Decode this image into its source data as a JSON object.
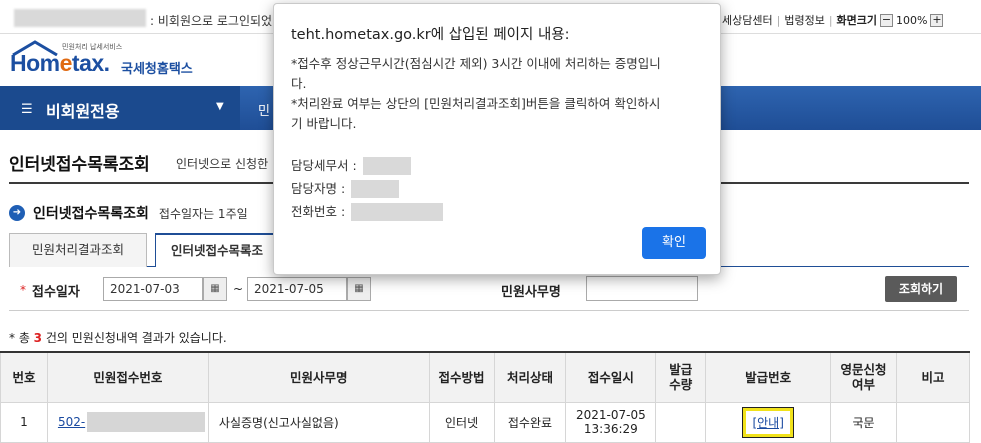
{
  "topbar": {
    "notice": ": 비회원으로 로그인되었",
    "links": [
      "세상담센터",
      "법령정보",
      "화면크기"
    ],
    "zoom_minus": "−",
    "zoom_value": "100%",
    "zoom_plus": "+"
  },
  "logo": {
    "small": "민원처리 납세서비스",
    "main_a": "Hom",
    "main_b": "e",
    "main_c": "tax.",
    "sub": "국세청홈택스"
  },
  "nav": {
    "title": "비회원전용",
    "second": "민"
  },
  "page": {
    "title": "인터넷접수목록조회",
    "desc": "인터넷으로 신청한"
  },
  "section": {
    "title": "인터넷접수목록조회",
    "desc": "접수일자는 1주일"
  },
  "tabs": [
    "민원처리결과조회",
    "인터넷접수목록조"
  ],
  "search": {
    "star": "*",
    "date_label": "접수일자",
    "date_from": "2021-07-03",
    "date_to": "2021-07-05",
    "tilde": "~",
    "civil_label": "민원사무명",
    "civil_value": "",
    "button": "조회하기"
  },
  "result": {
    "prefix": "* 총 ",
    "count": "3",
    "suffix": " 건의 민원신청내역 결과가 있습니다."
  },
  "table": {
    "headers": [
      "번호",
      "민원접수번호",
      "민원사무명",
      "접수방법",
      "처리상태",
      "접수일시",
      "발급\n수량",
      "발급번호",
      "영문신청\n여부",
      "비고"
    ],
    "rows": [
      {
        "no": "1",
        "receipt_no": "502-",
        "name": "사실증명(신고사실없음)",
        "method": "인터넷",
        "status": "접수완료",
        "date": "2021-07-05",
        "time": "13:36:29",
        "qty": "",
        "issue_no": "[안내]",
        "english": "국문",
        "note": ""
      }
    ]
  },
  "modal": {
    "title": "teht.hometax.go.kr에 삽입된 페이지 내용:",
    "line1": "*접수후 정상근무시간(점심시간 제외) 3시간 이내에 처리하는 증명입니",
    "line2": "다.",
    "line3": "*처리완료 여부는 상단의 [민원처리결과조회]버튼을 클릭하여 확인하시",
    "line4": "기 바랍니다.",
    "office_label": "담당세무서 :",
    "person_label": "담당자명 :",
    "phone_label": "전화번호 :",
    "ok": "확인"
  }
}
